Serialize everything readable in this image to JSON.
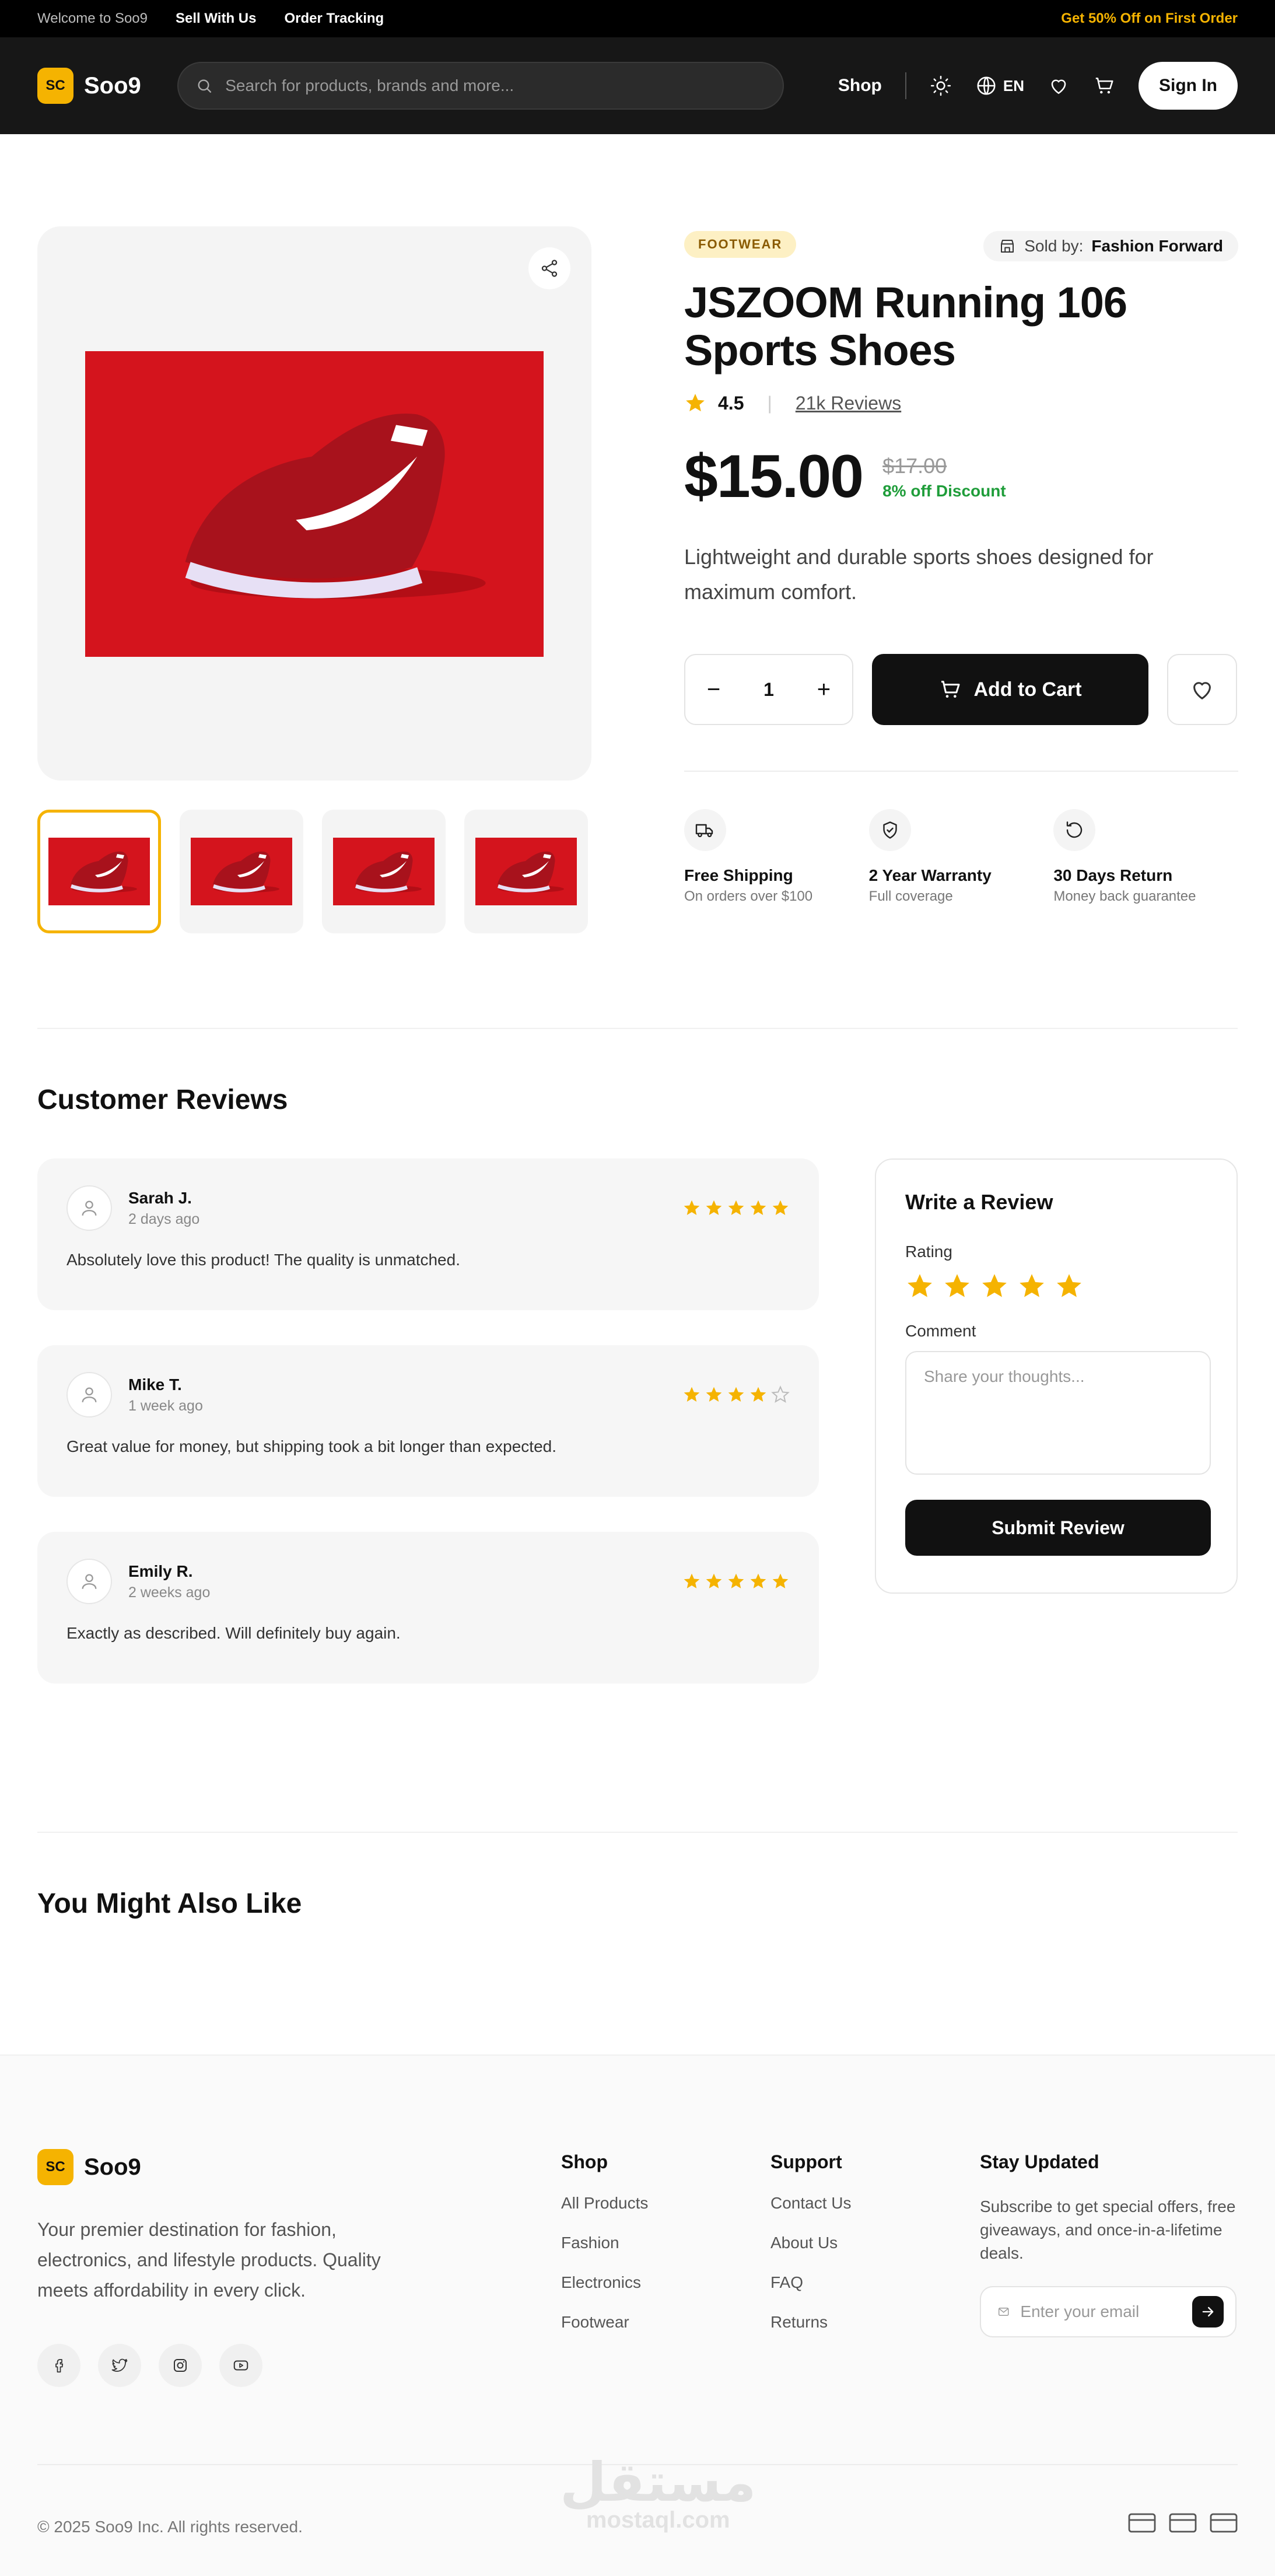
{
  "topbar": {
    "welcome": "Welcome to Soo9",
    "sell": "Sell With Us",
    "tracking": "Order Tracking",
    "promo": "Get 50% Off on First Order"
  },
  "header": {
    "logo_badge": "SC",
    "logo_text": "Soo9",
    "search_placeholder": "Search for products, brands and more...",
    "shop": "Shop",
    "lang": "EN",
    "sign_in": "Sign In"
  },
  "product": {
    "category": "FOOTWEAR",
    "sold_by_label": "Sold by:",
    "sold_by": "Fashion Forward",
    "title_line1": "JSZOOM Running 106",
    "title_line2": "Sports Shoes",
    "rating": "4.5",
    "reviews_link": "21k Reviews",
    "price": "$15.00",
    "old_price": "$17.00",
    "discount": "8% off Discount",
    "description": "Lightweight and durable sports shoes designed for maximum comfort.",
    "quantity": "1",
    "add_to_cart": "Add to Cart",
    "thumbnails": 4,
    "active_thumbnail": 1
  },
  "features": [
    {
      "title": "Free Shipping",
      "subtitle": "On orders over $100",
      "icon": "truck-icon"
    },
    {
      "title": "2 Year Warranty",
      "subtitle": "Full coverage",
      "icon": "shield-check-icon"
    },
    {
      "title": "30 Days Return",
      "subtitle": "Money back guarantee",
      "icon": "rotate-ccw-icon"
    }
  ],
  "reviews": {
    "title": "Customer Reviews",
    "items": [
      {
        "name": "Sarah J.",
        "date": "2 days ago",
        "stars": 5,
        "text": "Absolutely love this product! The quality is unmatched."
      },
      {
        "name": "Mike T.",
        "date": "1 week ago",
        "stars": 4,
        "text": "Great value for money, but shipping took a bit longer than expected."
      },
      {
        "name": "Emily R.",
        "date": "2 weeks ago",
        "stars": 5,
        "text": "Exactly as described. Will definitely buy again."
      }
    ]
  },
  "write_review": {
    "title": "Write a Review",
    "rating_label": "Rating",
    "comment_label": "Comment",
    "comment_placeholder": "Share your thoughts...",
    "submit": "Submit Review",
    "selected_stars": 5
  },
  "also_like": {
    "title": "You Might Also Like"
  },
  "footer": {
    "logo_badge": "SC",
    "logo_text": "Soo9",
    "tagline": "Your premier destination for fashion, electronics, and lifestyle products. Quality meets affordability in every click.",
    "shop_title": "Shop",
    "shop_items": [
      "All Products",
      "Fashion",
      "Electronics",
      "Footwear"
    ],
    "support_title": "Support",
    "support_items": [
      "Contact Us",
      "About Us",
      "FAQ",
      "Returns"
    ],
    "newsletter_title": "Stay Updated",
    "newsletter_text": "Subscribe to get special offers, free giveaways, and once-in-a-lifetime deals.",
    "email_placeholder": "Enter your email",
    "copyright": "© 2025 Soo9 Inc. All rights reserved.",
    "socials": [
      "facebook-icon",
      "twitter-icon",
      "instagram-icon",
      "youtube-icon"
    ]
  },
  "watermark": {
    "arabic": "مستقل",
    "latin": "mostaql.com"
  },
  "colors": {
    "accent": "#f5b301",
    "dark": "#111111",
    "discount": "#1f9d3a",
    "shoe_bg": "#d4141d"
  }
}
